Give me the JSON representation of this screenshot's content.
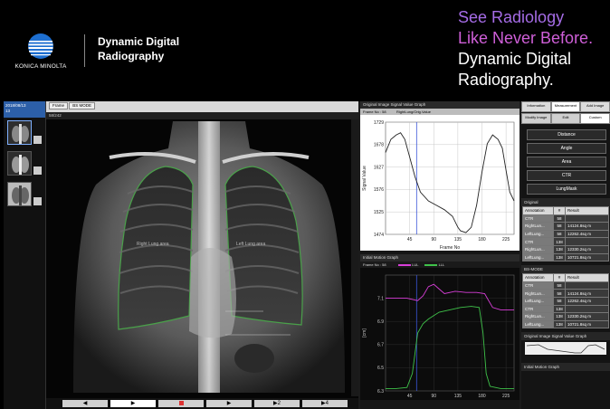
{
  "banner": {
    "logo_text": "KONICA MINOLTA",
    "product_line1": "Dynamic Digital",
    "product_line2": "Radiography",
    "tagline_line1": "See Radiology",
    "tagline_line2": "Like Never Before.",
    "tagline_line3": "Dynamic Digital",
    "tagline_line4": "Radiography."
  },
  "colors": {
    "accent_blue": "#2c5fa8",
    "tagline_purple": "#a56ce6",
    "tagline_magenta": "#cf5fd8",
    "lung_outline": "#4aa04a",
    "series_magenta": "#d83ed8",
    "series_green": "#3fc24a"
  },
  "thumbnails": {
    "header_line1": "2018/08/13",
    "header_line2": "13"
  },
  "viewer": {
    "tab_frame": "Frame",
    "tab_mode": "BS MODE",
    "frame_counter": "58/242",
    "roi_left_label": "Left Lung area",
    "roi_right_label": "Right Lung area",
    "playback": [
      "◀",
      "▶",
      "■",
      "▶",
      "▶2",
      "▶4"
    ]
  },
  "graph1": {
    "title": "Original Image Signal Value Graph",
    "frame_label": "Frame No : 58",
    "legend": "RightLung/Orig.Value"
  },
  "graph2": {
    "title": "Initial Motion Graph",
    "frame_label": "Frame No : 58",
    "legend_a": "LUL",
    "legend_b": "LLL"
  },
  "right_panel": {
    "tabs": [
      "Information",
      "Measurement",
      "Add Image"
    ],
    "subtabs": [
      "Modify Image",
      "Edit",
      "Custom"
    ],
    "tools": [
      "Distance",
      "Angle",
      "Area",
      "CTR",
      "LungMask"
    ],
    "section_original": "Original",
    "section_bsmode": "BS-MODE",
    "section_graph1": "Original Image Signal Value Graph",
    "section_graph2": "Initial Motion Graph",
    "table_headers": [
      "Annotation",
      "#",
      "Result"
    ],
    "original_rows": [
      [
        "CTR",
        "58",
        ""
      ],
      [
        "RightLun...",
        "58",
        "14124.8sq m"
      ],
      [
        "LeftLung...",
        "58",
        "12262.4sq m"
      ],
      [
        "CTR",
        "138",
        ""
      ],
      [
        "RightLun...",
        "138",
        "12330.2sq m"
      ],
      [
        "LeftLung...",
        "138",
        "10721.8sq m"
      ]
    ],
    "bsmode_rows": [
      [
        "CTR",
        "58",
        ""
      ],
      [
        "RightLun...",
        "58",
        "14124.8sq m"
      ],
      [
        "LeftLung...",
        "58",
        "12262.4sq m"
      ],
      [
        "CTR",
        "138",
        ""
      ],
      [
        "RightLun...",
        "138",
        "12330.2sq m"
      ],
      [
        "LeftLung...",
        "138",
        "10721.8sq m"
      ]
    ]
  },
  "chart_data": [
    {
      "type": "line",
      "title": "Original Image Signal Value Graph",
      "xlabel": "Frame No",
      "ylabel": "Signal Value",
      "xlim": [
        0,
        240
      ],
      "ylim": [
        1474,
        1729
      ],
      "xticks": [
        45,
        90,
        135,
        180,
        225
      ],
      "yticks": [
        1474,
        1525,
        1576,
        1627,
        1678,
        1729
      ],
      "current_frame": 58,
      "series": [
        {
          "name": "RightLung/Orig.Value",
          "x": [
            0,
            10,
            20,
            28,
            36,
            45,
            55,
            65,
            80,
            95,
            110,
            125,
            135,
            140,
            150,
            160,
            170,
            180,
            190,
            200,
            210,
            218,
            225,
            232,
            240
          ],
          "y": [
            1660,
            1690,
            1700,
            1705,
            1690,
            1650,
            1605,
            1570,
            1550,
            1540,
            1530,
            1515,
            1490,
            1482,
            1478,
            1490,
            1540,
            1615,
            1680,
            1700,
            1690,
            1670,
            1620,
            1570,
            1550
          ]
        }
      ]
    },
    {
      "type": "line",
      "title": "Initial Motion Graph",
      "xlabel": "",
      "ylabel": "[cm]",
      "xlim": [
        0,
        240
      ],
      "ylim": [
        6.3,
        7.3
      ],
      "xticks": [
        45,
        90,
        135,
        180,
        225
      ],
      "yticks": [
        6.3,
        6.5,
        6.7,
        6.9,
        7.1
      ],
      "current_frame": 58,
      "series": [
        {
          "name": "LUL",
          "color": "#d83ed8",
          "x": [
            0,
            20,
            40,
            60,
            70,
            80,
            90,
            100,
            110,
            130,
            150,
            170,
            185,
            190,
            200,
            215,
            230,
            240
          ],
          "y": [
            7.1,
            7.1,
            7.1,
            7.08,
            7.12,
            7.2,
            7.22,
            7.18,
            7.14,
            7.16,
            7.15,
            7.15,
            7.14,
            7.1,
            7.02,
            7.0,
            7.0,
            7.0
          ]
        },
        {
          "name": "LLL",
          "color": "#3fc24a",
          "x": [
            0,
            20,
            40,
            50,
            60,
            70,
            80,
            90,
            100,
            120,
            140,
            160,
            175,
            182,
            188,
            195,
            205,
            215,
            225,
            240
          ],
          "y": [
            6.32,
            6.32,
            6.33,
            6.45,
            6.8,
            6.88,
            6.92,
            6.95,
            6.98,
            7.0,
            7.02,
            7.03,
            7.02,
            6.8,
            6.45,
            6.34,
            6.33,
            6.32,
            6.32,
            6.32
          ]
        }
      ]
    }
  ]
}
